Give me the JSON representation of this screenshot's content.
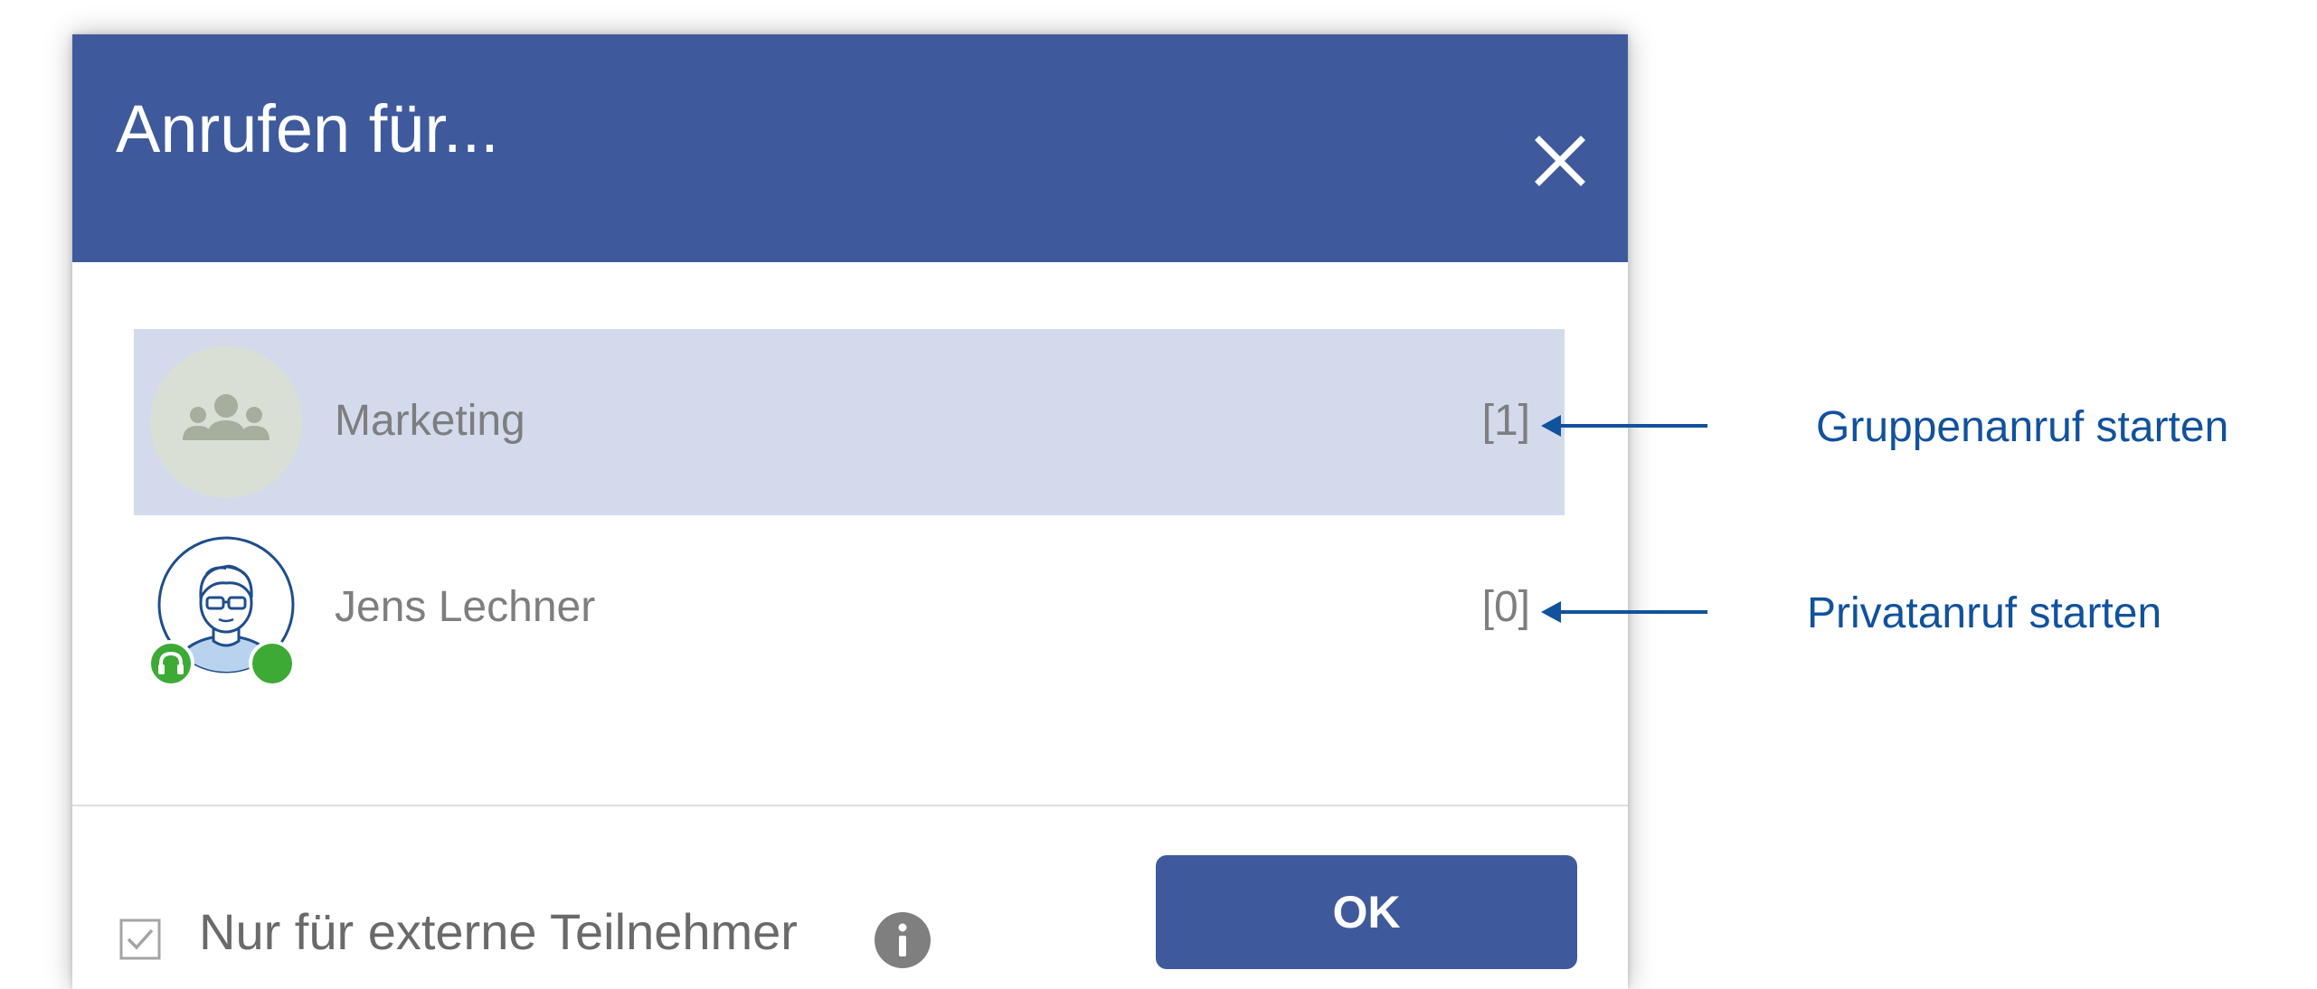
{
  "dialog": {
    "title": "Anrufen für...",
    "close_icon": "close-icon"
  },
  "targets": [
    {
      "label": "Marketing",
      "count": "[1]",
      "type": "group",
      "selected": true,
      "icon": "group-icon"
    },
    {
      "label": "Jens Lechner",
      "count": "[0]",
      "type": "person",
      "selected": false,
      "icon": "user-avatar"
    }
  ],
  "footer": {
    "checkbox_label": "Nur für externe Teilnehmer",
    "checkbox_checked": true,
    "info_icon": "info-icon",
    "ok_label": "OK"
  },
  "annotations": [
    {
      "text": "Gruppenanruf starten"
    },
    {
      "text": "Privatanruf starten"
    }
  ],
  "colors": {
    "header": "#3f5a9c",
    "selected_row": "#d3daec",
    "annotation": "#11529d",
    "status_green": "#3daa35"
  }
}
